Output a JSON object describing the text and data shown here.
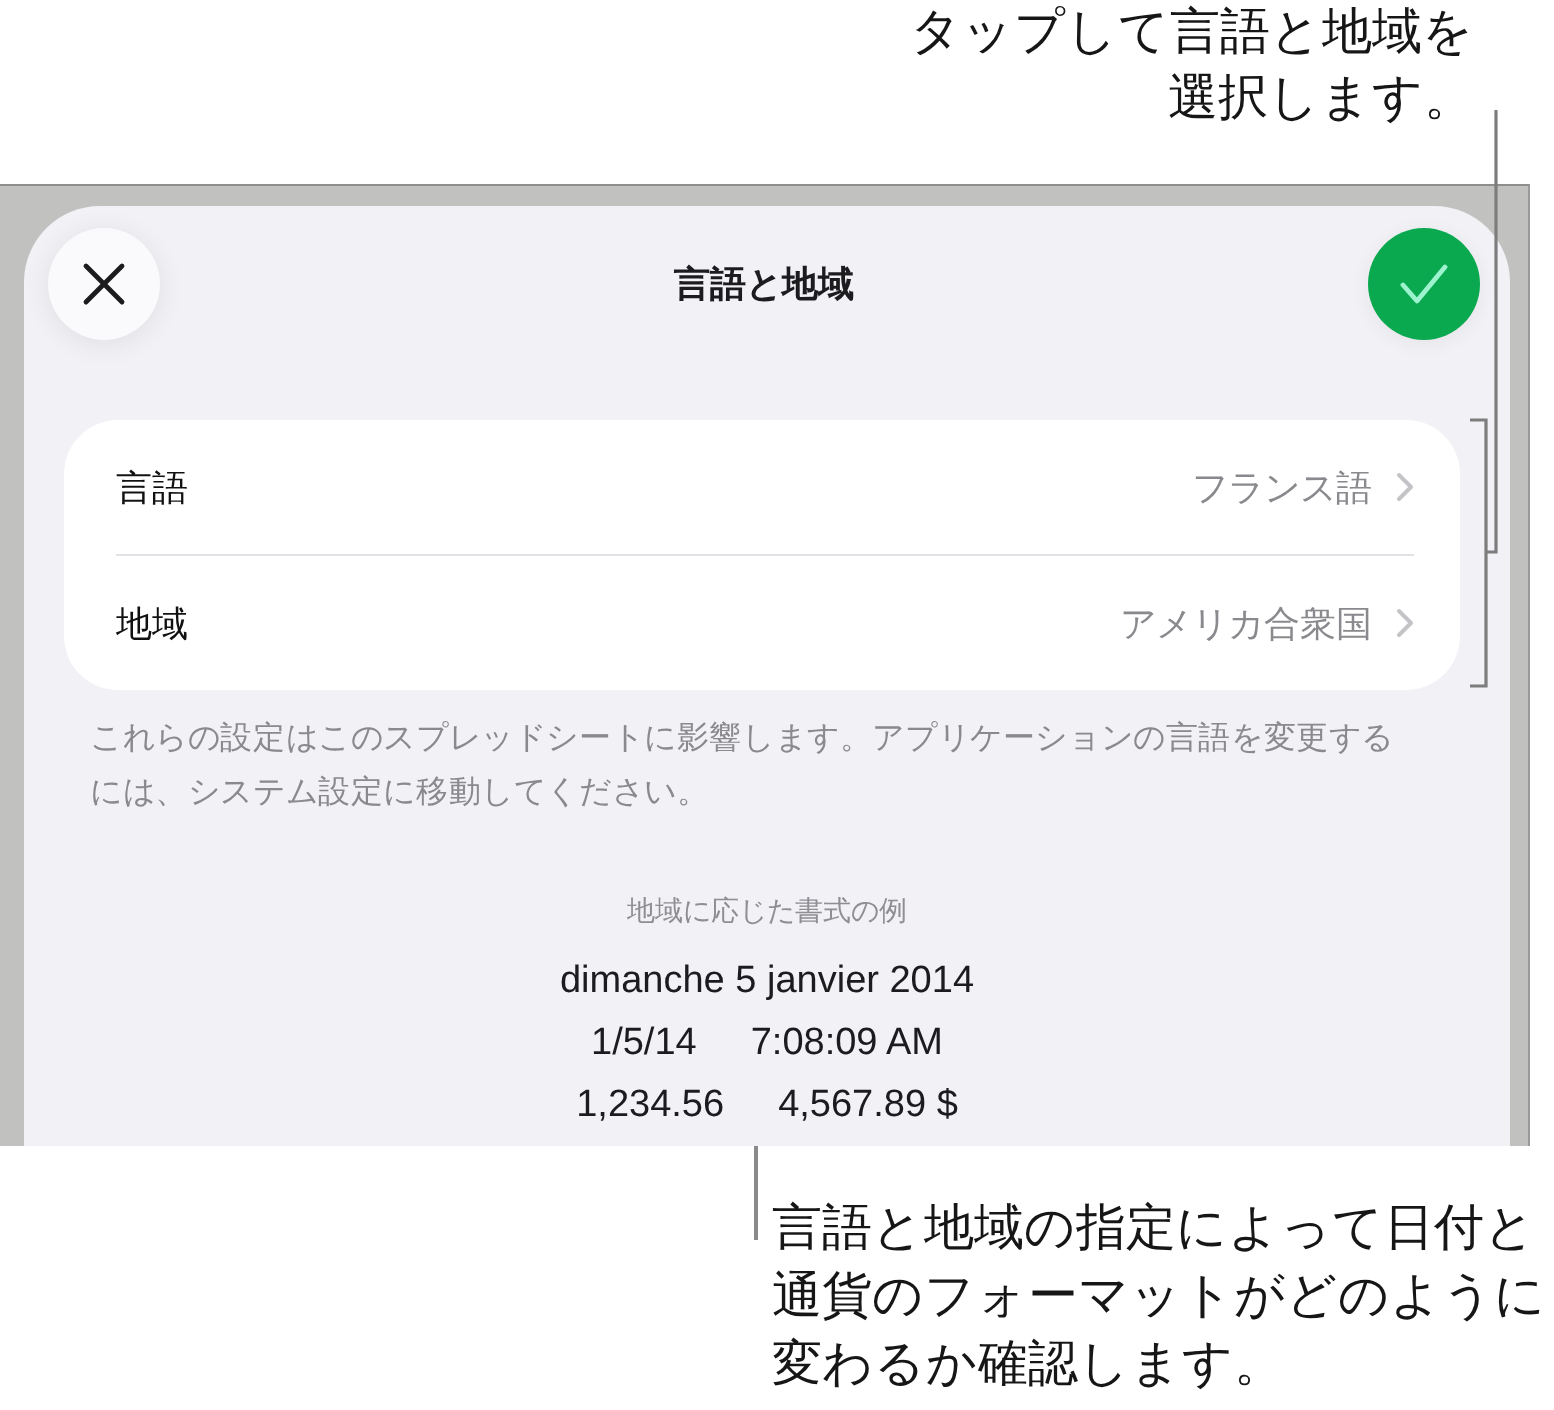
{
  "callouts": {
    "top": "タップして言語と地域を選択します。",
    "bottom": "言語と地域の指定によって日付と通貨のフォーマットがどのように変わるか確認します。"
  },
  "sheet": {
    "title": "言語と地域",
    "settings": [
      {
        "label": "言語",
        "value": "フランス語"
      },
      {
        "label": "地域",
        "value": "アメリカ合衆国"
      }
    ],
    "note": "これらの設定はこのスプレッドシートに影響します。アプリケーションの言語を変更するには、システム設定に移動してください。",
    "examples": {
      "heading": "地域に応じた書式の例",
      "lines": [
        {
          "items": [
            "dimanche 5 janvier 2014"
          ]
        },
        {
          "items": [
            "1/5/14",
            "7:08:09 AM"
          ]
        },
        {
          "items": [
            "1,234.56",
            "4,567.89 $"
          ]
        }
      ]
    }
  }
}
